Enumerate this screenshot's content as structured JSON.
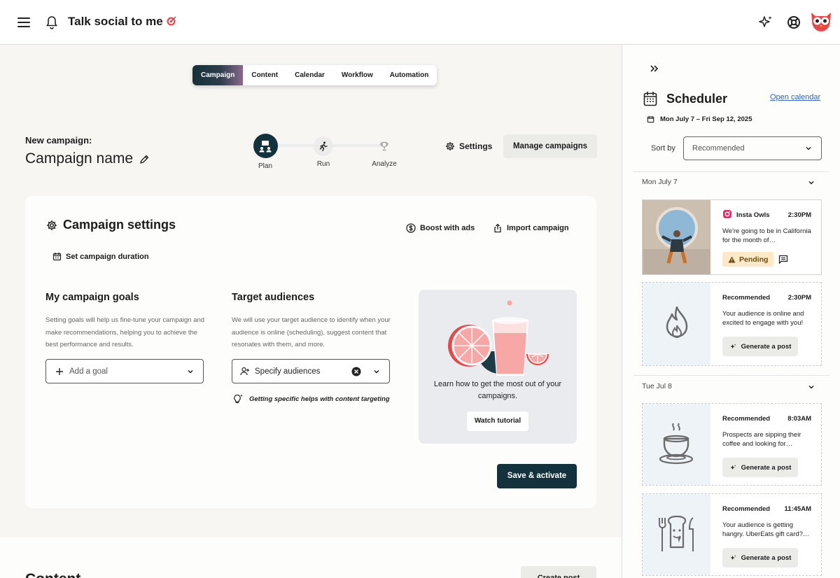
{
  "topbar": {
    "title": "Talk social to me"
  },
  "tabs": [
    "Campaign",
    "Content",
    "Calendar",
    "Workflow",
    "Automation"
  ],
  "campaign": {
    "new_label": "New campaign:",
    "name": "Campaign name",
    "steps": [
      "Plan",
      "Run",
      "Analyze"
    ],
    "settings_label": "Settings",
    "manage_label": "Manage campaigns"
  },
  "settings_card": {
    "title": "Campaign settings",
    "boost_label": "Boost with ads",
    "import_label": "Import campaign",
    "duration_label": "Set campaign duration",
    "goals": {
      "title": "My campaign goals",
      "desc": "Setting goals will help us fine-tune your campaign and make recommendations, helping you to achieve the best performance and results.",
      "placeholder": "Add a goal"
    },
    "audiences": {
      "title": "Target audiences",
      "desc": "We will use your target audience to identify when your audience is online (scheduling), suggest content that resonates with them, and more.",
      "placeholder": "Specify audiences",
      "tip": "Getting specific helps with content targeting"
    },
    "promo": {
      "text": "Learn how to get the most out of your campaigns.",
      "button": "Watch tutorial"
    },
    "save_label": "Save & activate"
  },
  "content_section": {
    "title": "Content",
    "create_label": "Create post"
  },
  "scheduler": {
    "title": "Scheduler",
    "open_calendar": "Open calendar",
    "date_range": "Mon July 7 – Fri Sep 12, 2025",
    "sort_by_label": "Sort by",
    "sort_value": "Recommended",
    "days": [
      {
        "label": "Mon July 7",
        "posts": [
          {
            "account": "Insta Owls",
            "time": "2:30PM",
            "text": "We're going to be in California for the month of…",
            "status": "Pending"
          },
          {
            "account": "Recommended",
            "time": "2:30PM",
            "text": "Your audience is online and excited to engage with you!",
            "action": "Generate a post"
          }
        ]
      },
      {
        "label": "Tue Jul 8",
        "posts": [
          {
            "account": "Recommended",
            "time": "8:03AM",
            "text": "Prospects are sipping their coffee and looking for…",
            "action": "Generate a post"
          },
          {
            "account": "Recommended",
            "time": "11:45AM",
            "text": "Your audience is getting hangry. UberEats gift card?…",
            "action": "Generate a post"
          }
        ]
      }
    ]
  },
  "colors": {
    "primary": "#14323d",
    "link": "#2a63b8",
    "pending_bg": "#fde9c8",
    "accent_red": "#e8484a"
  }
}
